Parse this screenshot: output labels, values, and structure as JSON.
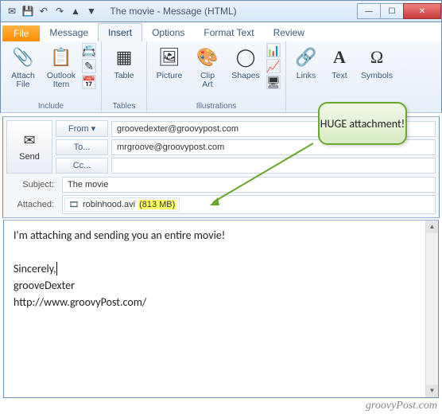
{
  "window": {
    "title": "The movie  -  Message (HTML)"
  },
  "qat": {
    "save_icon": "💾",
    "undo_icon": "↶",
    "redo_icon": "↷",
    "prev_icon": "▲",
    "next_icon": "▼"
  },
  "winbtns": {
    "min": "—",
    "max": "☐",
    "close": "✕"
  },
  "tabs": {
    "file": "File",
    "items": [
      "Message",
      "Insert",
      "Options",
      "Format Text",
      "Review"
    ],
    "active_index": 1
  },
  "ribbon": {
    "groups": [
      {
        "label": "Include",
        "buttons": [
          {
            "name": "attach-file",
            "label": "Attach\nFile",
            "glyph": "📎"
          },
          {
            "name": "outlook-item",
            "label": "Outlook\nItem",
            "glyph": "📋"
          }
        ],
        "small": [
          "📇",
          "✎",
          "📅"
        ]
      },
      {
        "label": "Tables",
        "buttons": [
          {
            "name": "table",
            "label": "Table",
            "glyph": "▦"
          }
        ]
      },
      {
        "label": "Illustrations",
        "buttons": [
          {
            "name": "picture",
            "label": "Picture",
            "glyph": "🖼"
          },
          {
            "name": "clip-art",
            "label": "Clip\nArt",
            "glyph": "🎨"
          },
          {
            "name": "shapes",
            "label": "Shapes",
            "glyph": "◯"
          }
        ],
        "small": [
          "📊",
          "📈",
          "🖥"
        ]
      },
      {
        "label": "",
        "buttons": [
          {
            "name": "links",
            "label": "Links",
            "glyph": "🔗"
          },
          {
            "name": "text",
            "label": "Text",
            "glyph": "A"
          },
          {
            "name": "symbols",
            "label": "Symbols",
            "glyph": "Ω"
          }
        ]
      }
    ]
  },
  "compose": {
    "send_label": "Send",
    "from_label": "From ▾",
    "from_value": "groovedexter@groovypost.com",
    "to_label": "To...",
    "to_value": "mrgroove@groovypost.com",
    "cc_label": "Cc...",
    "cc_value": "",
    "subject_label": "Subject:",
    "subject_value": "The movie",
    "attached_label": "Attached:",
    "attachment": {
      "icon": "🎞",
      "filename": "robinhood.avi",
      "size": "(813 MB)"
    }
  },
  "body": {
    "line1": "I'm attaching and sending you an entire movie!",
    "blank": " ",
    "sig1": "Sincerely,",
    "sig2": "grooveDexter",
    "sig3": "http://www.groovyPost.com/"
  },
  "callout": {
    "text": "HUGE attachment!"
  },
  "watermark": "groovyPost.com"
}
